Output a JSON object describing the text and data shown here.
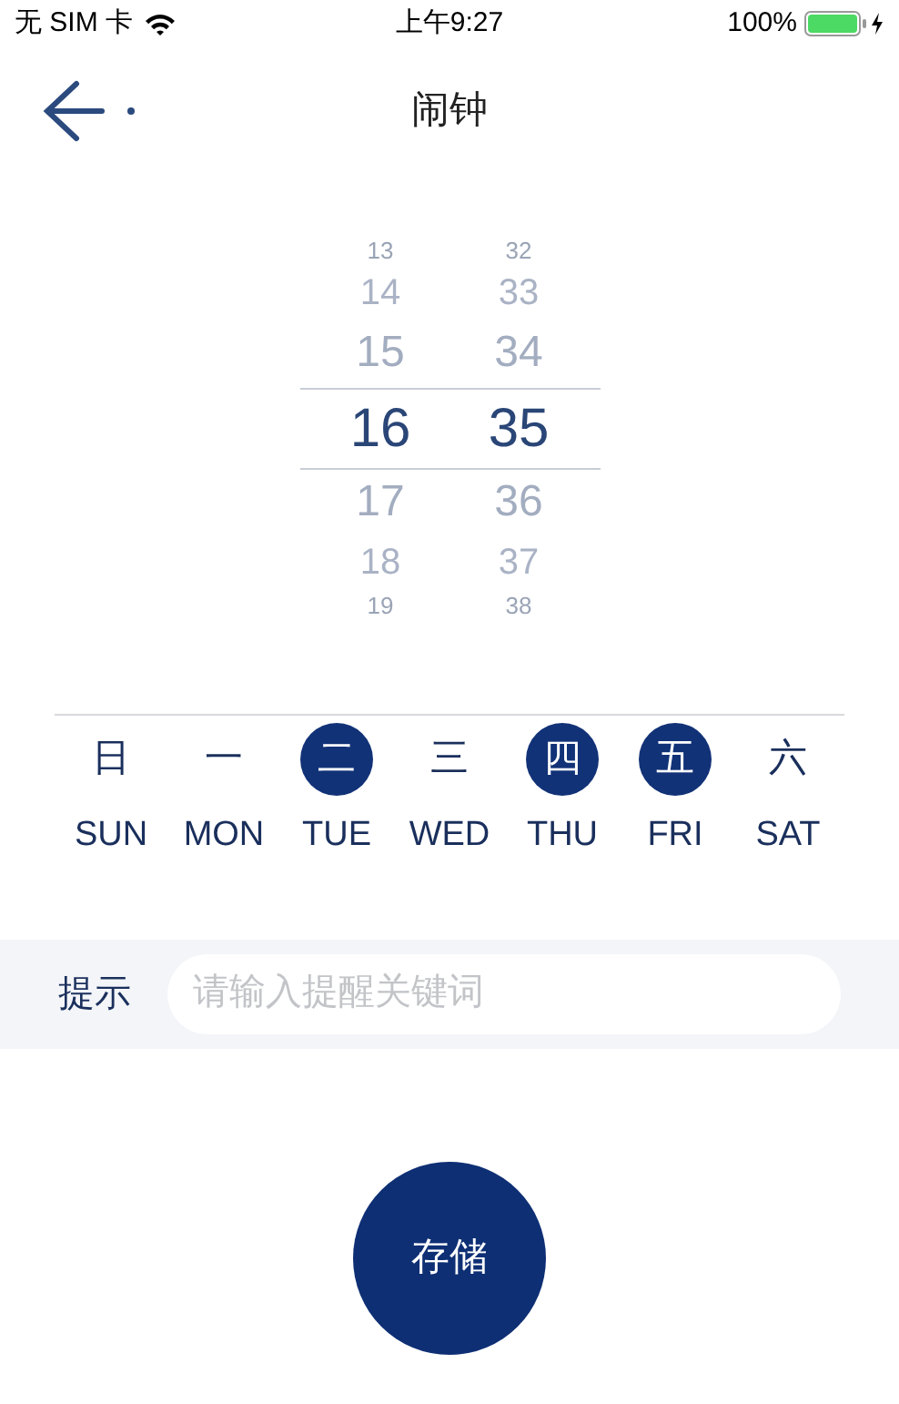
{
  "status_bar": {
    "carrier": "无 SIM 卡",
    "time": "上午9:27",
    "battery": "100%"
  },
  "nav": {
    "title": "闹钟"
  },
  "picker": {
    "columns": [
      {
        "items": [
          {
            "label": "13",
            "selected": false
          },
          {
            "label": "14",
            "selected": false
          },
          {
            "label": "15",
            "selected": false
          },
          {
            "label": "16",
            "selected": true
          },
          {
            "label": "17",
            "selected": false
          },
          {
            "label": "18",
            "selected": false
          },
          {
            "label": "19",
            "selected": false
          }
        ]
      },
      {
        "items": [
          {
            "label": "32",
            "selected": false
          },
          {
            "label": "33",
            "selected": false
          },
          {
            "label": "34",
            "selected": false
          },
          {
            "label": "35",
            "selected": true
          },
          {
            "label": "36",
            "selected": false
          },
          {
            "label": "37",
            "selected": false
          },
          {
            "label": "38",
            "selected": false
          }
        ]
      }
    ]
  },
  "days": [
    {
      "label": "日",
      "abbr": "SUN",
      "selected": false
    },
    {
      "label": "一",
      "abbr": "MON",
      "selected": false
    },
    {
      "label": "二",
      "abbr": "TUE",
      "selected": true
    },
    {
      "label": "三",
      "abbr": "WED",
      "selected": false
    },
    {
      "label": "四",
      "abbr": "THU",
      "selected": true
    },
    {
      "label": "五",
      "abbr": "FRI",
      "selected": true
    },
    {
      "label": "六",
      "abbr": "SAT",
      "selected": false
    }
  ],
  "hint": {
    "label": "提示",
    "placeholder": "请输入提醒关键词"
  },
  "save_button": "存储"
}
